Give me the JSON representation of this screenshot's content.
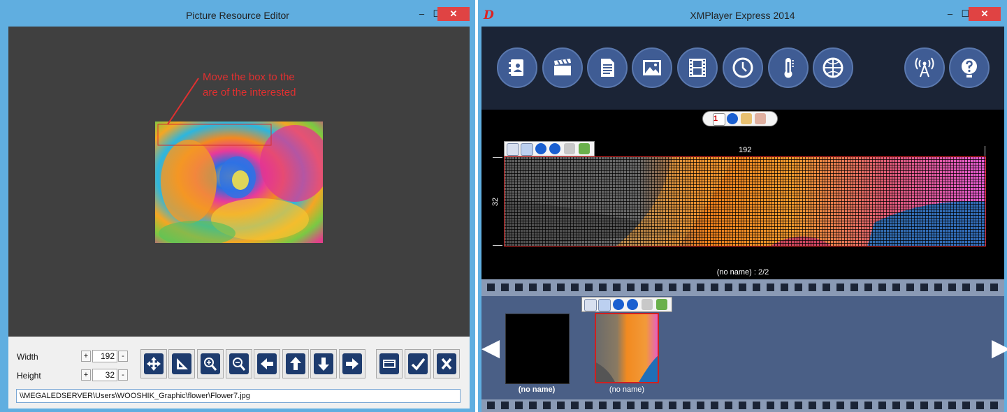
{
  "editor": {
    "title": "Picture Resource Editor",
    "minimize": "–",
    "maximize": "☐",
    "close": "✕",
    "annotation_line1": "Move the box to the",
    "annotation_line2": "are of the interested",
    "width_label": "Width",
    "height_label": "Height",
    "width_value": "192",
    "height_value": "32",
    "plus": "+",
    "minus": "-",
    "tools": [
      "move-icon",
      "fit-icon",
      "zoom-in-icon",
      "zoom-out-icon",
      "left-arrow-icon",
      "up-arrow-icon",
      "down-arrow-icon",
      "right-arrow-icon",
      "crop-icon",
      "check-icon",
      "cancel-icon"
    ],
    "path": "\\\\MEGALEDSERVER\\Users\\WOOSHIK_Graphic\\flower\\Flower7.jpg",
    "accent": "#1d3b6e",
    "annotation_color": "#e03030"
  },
  "player": {
    "title": "XMPlayer Express 2014",
    "logo": "D",
    "minimize": "–",
    "maximize": "☐",
    "close": "✕",
    "toolbar_icons": [
      "contacts-icon",
      "clapper-icon",
      "document-icon",
      "image-icon",
      "film-icon",
      "clock-icon",
      "thermometer-icon",
      "globe-icon",
      "broadcast-icon",
      "help-icon"
    ],
    "preview_width": "192",
    "preview_height": "32",
    "preview_caption": "(no name) : 2/2",
    "thumbnails": [
      {
        "label": "(no name)"
      },
      {
        "label": "(no name)"
      }
    ],
    "prev_arrow": "◀",
    "next_arrow": "▶"
  }
}
